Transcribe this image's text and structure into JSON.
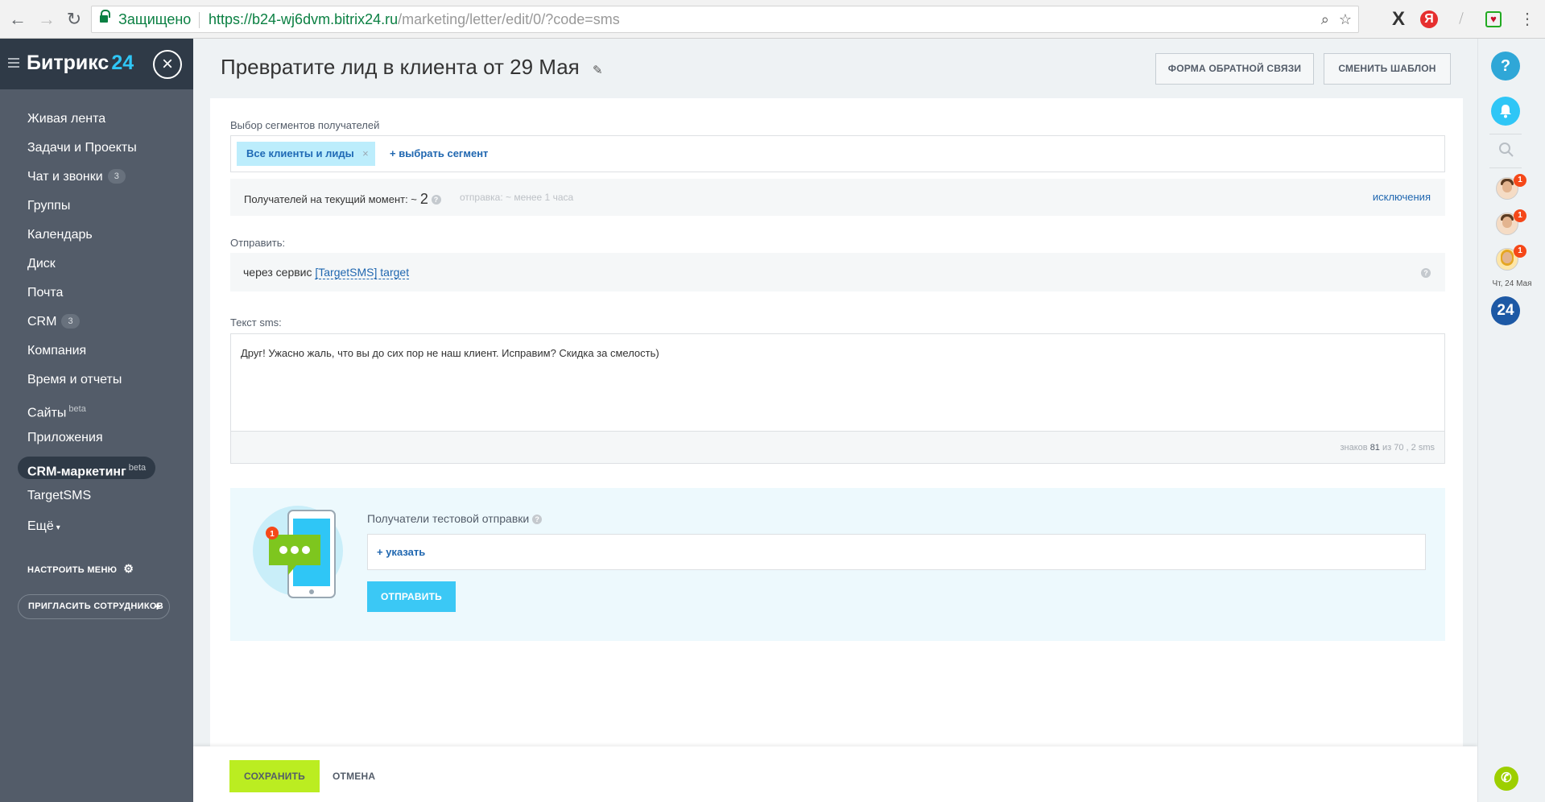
{
  "browser": {
    "secure_label": "Защищено",
    "url_scheme": "https://",
    "url_host": "b24-wj6dvm.bitrix24.ru",
    "url_path": "/marketing/letter/edit/0/?code=sms"
  },
  "sidebar": {
    "logo_text": "Битрикс",
    "logo_num": "24",
    "items": [
      {
        "label": "Живая лента"
      },
      {
        "label": "Задачи и Проекты"
      },
      {
        "label": "Чат и звонки",
        "count": "3"
      },
      {
        "label": "Группы"
      },
      {
        "label": "Календарь"
      },
      {
        "label": "Диск"
      },
      {
        "label": "Почта"
      },
      {
        "label": "CRM",
        "count": "3"
      },
      {
        "label": "Компания"
      },
      {
        "label": "Время и отчеты"
      },
      {
        "label": "Сайты",
        "sup": "beta"
      },
      {
        "label": "Приложения"
      },
      {
        "label": "CRM-маркетинг",
        "sup": "beta"
      },
      {
        "label": "TargetSMS"
      },
      {
        "label": "Ещё"
      }
    ],
    "configure_menu": "НАСТРОИТЬ МЕНЮ",
    "invite": "ПРИГЛАСИТЬ СОТРУДНИКОВ"
  },
  "header": {
    "title": "Превратите лид в клиента от 29 Мая",
    "feedback_button": "ФОРМА ОБРАТНОЙ СВЯЗИ",
    "template_button": "СМЕНИТЬ ШАБЛОН"
  },
  "segments": {
    "label": "Выбор сегментов получателей",
    "selected": "Все клиенты и лиды",
    "add_link": "+ выбрать сегмент"
  },
  "recipients": {
    "label": "Получателей на текущий момент: ~",
    "count": "2",
    "send_time": "отправка: ~ менее 1 часа",
    "exclusions": "исключения"
  },
  "send": {
    "label": "Отправить:",
    "via": "через сервис",
    "service": "[TargetSMS] target"
  },
  "sms": {
    "label": "Текст sms:",
    "text": "Друг! Ужасно жаль, что вы до сих пор не наш клиент. Исправим? Скидка за смелость)",
    "counter_prefix": "знаков",
    "chars": "81",
    "counter_mid": "из 70 ,",
    "sms_count": "2 sms"
  },
  "test": {
    "label": "Получатели тестовой отправки",
    "add_link": "+ указать",
    "send_button": "ОТПРАВИТЬ",
    "illustration_badge": "1"
  },
  "footer": {
    "save": "СОХРАНИТЬ",
    "cancel": "ОТМЕНА"
  },
  "rightbar": {
    "help": "?",
    "badges": [
      "1",
      "1",
      "1"
    ],
    "date": "Чт, 24 Мая",
    "b24": "24"
  },
  "colors": {
    "sidebar_bg": "#535c69",
    "accent_blue": "#2fc6f6",
    "save_green": "#bbed21",
    "link_blue": "#2067b0"
  }
}
